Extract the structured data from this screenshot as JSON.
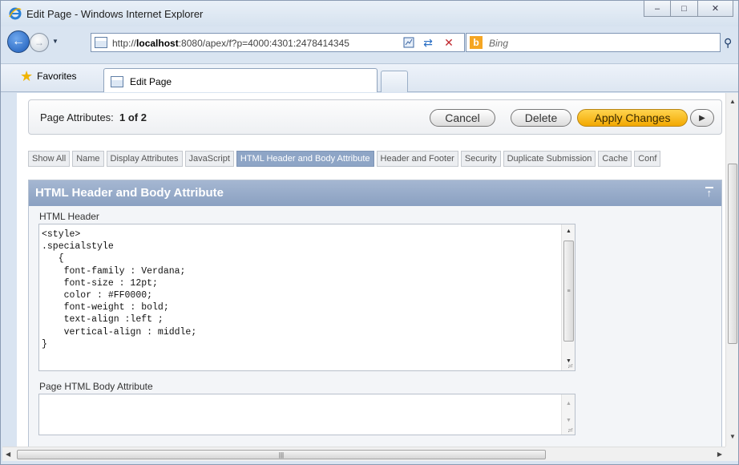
{
  "window": {
    "title": "Edit Page - Windows Internet Explorer",
    "controls": {
      "minimize": "–",
      "maximize": "□",
      "close": "✕"
    }
  },
  "address": {
    "url_prefix": "http://",
    "url_host": "localhost",
    "url_rest": ":8080/apex/f?p=4000:4301:2478414345",
    "search_placeholder": "Bing"
  },
  "favorites": {
    "label": "Favorites"
  },
  "tab": {
    "title": "Edit Page"
  },
  "attributes_bar": {
    "label": "Page Attributes:",
    "position": "1 of 2",
    "buttons": {
      "cancel": "Cancel",
      "delete": "Delete",
      "apply": "Apply Changes",
      "next": "▶"
    }
  },
  "section_tabs": [
    "Show All",
    "Name",
    "Display Attributes",
    "JavaScript",
    "HTML Header and Body Attribute",
    "Header and Footer",
    "Security",
    "Duplicate Submission",
    "Cache",
    "Conf"
  ],
  "active_tab_index": 4,
  "region": {
    "title": "HTML Header and Body Attribute",
    "html_header_label": "HTML Header",
    "html_header_lines": [
      "<style>",
      ".specialstyle",
      "   {",
      "    font-family : Verdana;",
      "    font-size : 12pt;",
      "    color : #FF0000;",
      "    font-weight : bold;",
      "    text-align :left ;",
      "    vertical-align : middle;",
      "}"
    ],
    "body_attr_label": "Page HTML Body Attribute",
    "body_attr_value": ""
  },
  "colors": {
    "apply_button": "#f2a800",
    "active_tab": "#8ea5c6",
    "region_header": "#8aa0c1"
  },
  "icons": [
    "ie-logo-icon",
    "back-arrow-icon",
    "forward-arrow-icon",
    "page-icon",
    "compatibility-icon",
    "refresh-icon",
    "stop-icon",
    "bing-icon",
    "search-icon",
    "favorites-star-icon"
  ]
}
